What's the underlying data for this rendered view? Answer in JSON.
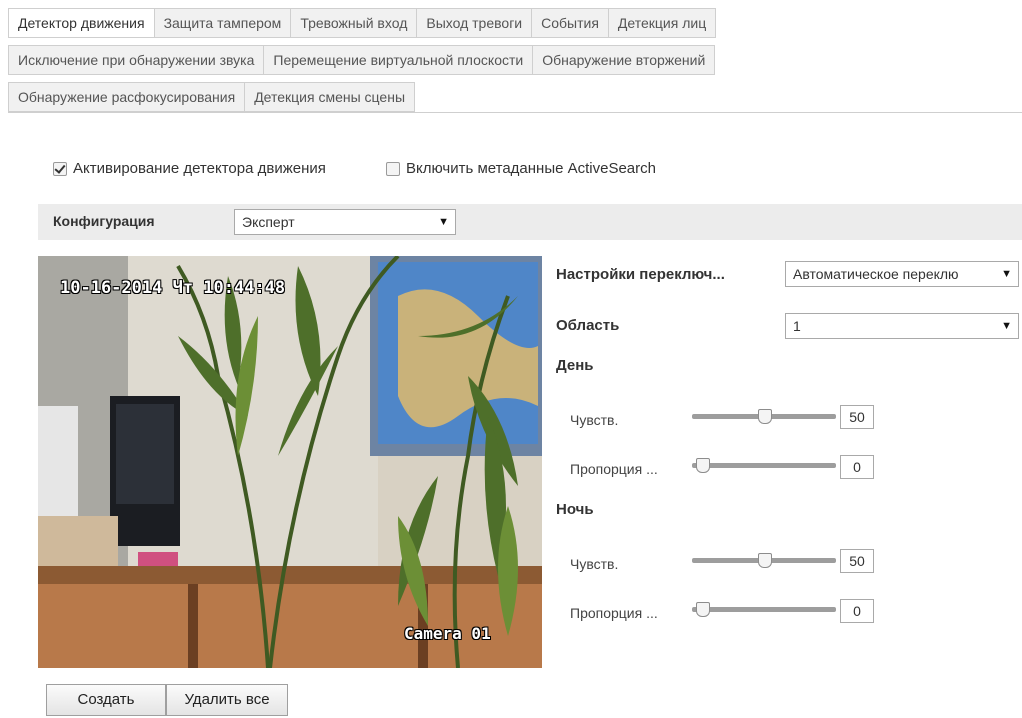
{
  "tabs": {
    "row1": [
      "Детектор движения",
      "Защита тампером",
      "Тревожный вход",
      "Выход тревоги",
      "События",
      "Детекция лиц"
    ],
    "row2": [
      "Исключение при обнаружении звука",
      "Перемещение виртуальной плоскости",
      "Обнаружение вторжений"
    ],
    "row3": [
      "Обнаружение расфокусирования",
      "Детекция смены сцены"
    ],
    "active": "Детектор движения"
  },
  "options": {
    "enable_motion": {
      "label": "Активирование детектора движения",
      "checked": true
    },
    "enable_activesearch": {
      "label": "Включить метаданные ActiveSearch",
      "checked": false
    }
  },
  "config": {
    "label": "Конфигурация",
    "value": "Эксперт"
  },
  "video": {
    "timestamp": "10-16-2014 Чт 10:44:48",
    "camera_name": "Camera 01"
  },
  "settings": {
    "switch_label": "Настройки переключ...",
    "switch_value": "Автоматическое переклю",
    "area_label": "Область",
    "area_value": "1",
    "day": {
      "title": "День",
      "sensitivity_label": "Чувств.",
      "sensitivity": 50,
      "proportion_label": "Пропорция ...",
      "proportion": 0
    },
    "night": {
      "title": "Ночь",
      "sensitivity_label": "Чувств.",
      "sensitivity": 50,
      "proportion_label": "Пропорция ...",
      "proportion": 0
    }
  },
  "buttons": {
    "create": "Создать",
    "delete_all": "Удалить все"
  },
  "colors": {
    "tab_bg": "#f1f1f1",
    "config_bar": "#ececec",
    "slider_track": "#9d9d9d"
  }
}
